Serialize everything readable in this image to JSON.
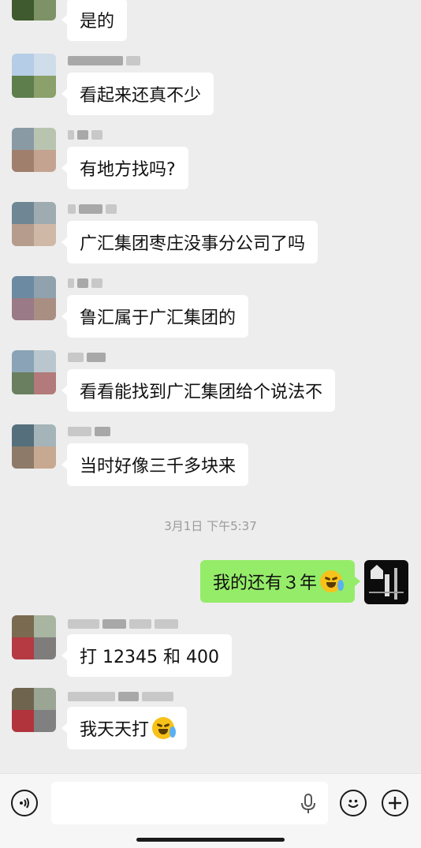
{
  "messages": [
    {
      "text": "是的"
    },
    {
      "text": "看起来还真不少"
    },
    {
      "text": "有地方找吗?"
    },
    {
      "text": "广汇集团枣庄没事分公司了吗"
    },
    {
      "text": "鲁汇属于广汇集团的"
    },
    {
      "text": "看看能找到广汇集团给个说法不"
    },
    {
      "text": "当时好像三千多块来"
    }
  ],
  "timestamp": "3月1日 下午5:37",
  "my_message": {
    "text": "我的还有３年",
    "emoji": "crying-laughing"
  },
  "later_messages": [
    {
      "text": "打 12345 和 400"
    },
    {
      "text": "我天天打",
      "emoji": "crying-laughing"
    }
  ],
  "input": {
    "value": "",
    "placeholder": ""
  },
  "colors": {
    "background": "#ededed",
    "my_bubble": "#95ec69",
    "their_bubble": "#ffffff"
  }
}
